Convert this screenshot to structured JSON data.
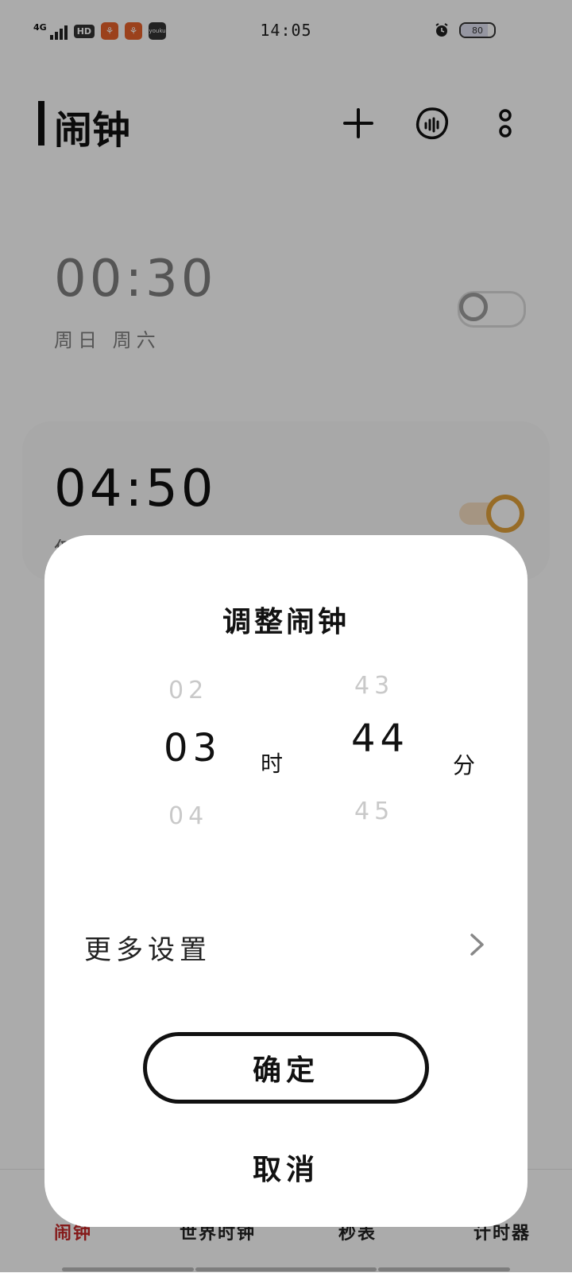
{
  "status_bar": {
    "network_label": "4G",
    "hd_label": "HD",
    "app_icon_label": "youku",
    "time": "14:05",
    "battery_percent": "80",
    "battery_level": 0.8
  },
  "header": {
    "title": "闹钟",
    "icons": [
      "plus-icon",
      "sound-wave-icon",
      "more-icon"
    ]
  },
  "alarms": [
    {
      "time": "00:30",
      "days": "周日 周六",
      "enabled": false
    },
    {
      "time": "04:50",
      "days": "仅",
      "enabled": true
    }
  ],
  "colors": {
    "accent": "#E2A23B",
    "toggle_on_track": "#F6DFC2",
    "toggle_off": "#BDBDBD",
    "nav_active": "#C62828"
  },
  "bottom_nav": {
    "items": [
      {
        "label": "闹钟",
        "active": true
      },
      {
        "label": "世界时钟",
        "active": false
      },
      {
        "label": "秒表",
        "active": false
      },
      {
        "label": "计时器",
        "active": false
      }
    ]
  },
  "dialog": {
    "title": "调整闹钟",
    "hour_picker": {
      "prev": "02",
      "selected": "03",
      "next": "04",
      "unit": "时"
    },
    "minute_picker": {
      "prev": "43",
      "selected": "44",
      "next": "45",
      "unit": "分"
    },
    "more_settings_label": "更多设置",
    "confirm_label": "确定",
    "cancel_label": "取消"
  }
}
